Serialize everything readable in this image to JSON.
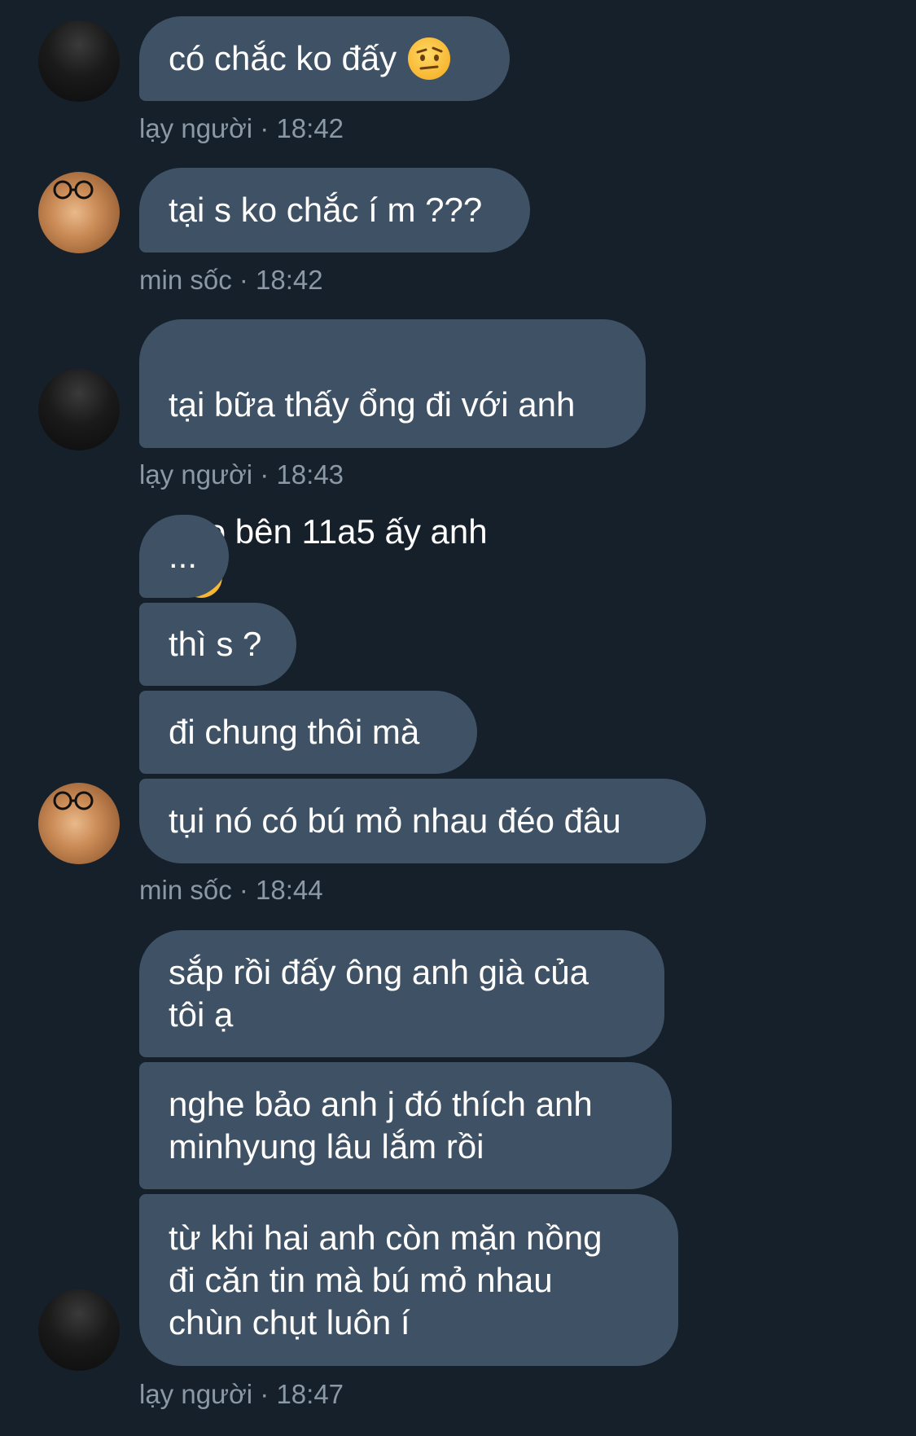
{
  "messages": [
    {
      "lines": [
        "có chắc ko đấy"
      ],
      "emoji": "raised-eyebrow-emoji",
      "sender": "lạy người",
      "time": "18:42",
      "meta": "lạy người · 18:42",
      "avatar": "avatar-boy"
    },
    {
      "lines": [
        "tại s ko chắc í m ???"
      ],
      "sender": "min sốc",
      "time": "18:42",
      "meta": "min sốc · 18:42",
      "avatar": "avatar-cat"
    },
    {
      "lines": [
        "tại bữa thấy ổng đi với anh",
        "nào bên 11a5 ấy anh"
      ],
      "emoji": "smiling-face-with-hearts-emoji",
      "sender": "lạy người",
      "time": "18:43",
      "meta": "lạy người · 18:43",
      "avatar": "avatar-boy"
    },
    {
      "bubbles": [
        "...",
        "thì s ?",
        "đi chung thôi mà",
        "tụi nó có bú mỏ nhau đéo đâu"
      ],
      "sender": "min sốc",
      "time": "18:44",
      "meta": "min sốc · 18:44",
      "avatar": "avatar-cat"
    },
    {
      "bubbles": [
        "sắp rồi đấy ông anh già của\ntôi ạ",
        "nghe bảo anh j đó thích anh\nminhyung lâu lắm rồi",
        "từ khi hai anh còn mặn nồng\nđi căn tin mà bú mỏ nhau\nchùn chụt luôn í"
      ],
      "sender": "lạy người",
      "time": "18:47",
      "meta": "lạy người · 18:47",
      "avatar": "avatar-boy"
    }
  ],
  "colors": {
    "background": "#15202b",
    "bubble": "#3f5164",
    "text": "#ffffff",
    "meta": "#8b98a5"
  }
}
